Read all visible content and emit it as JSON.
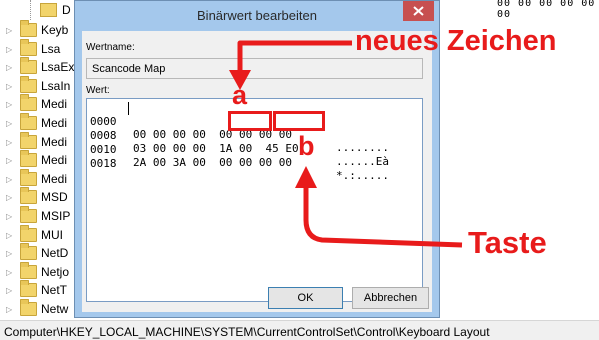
{
  "tree": {
    "top_item": "D",
    "items": [
      "Keyb",
      "Lsa",
      "LsaEx",
      "LsaIn",
      "Medi",
      "Medi",
      "Medi",
      "Medi",
      "Medi",
      "MSD",
      "MSIP",
      "MUI",
      "NetD",
      "Netjo",
      "NetT",
      "Netw"
    ]
  },
  "right_pane": {
    "hex_fragment": "00 00 00 00 00 00"
  },
  "status_bar": {
    "path": "Computer\\HKEY_LOCAL_MACHINE\\SYSTEM\\CurrentControlSet\\Control\\Keyboard Layout"
  },
  "dialog": {
    "title": "Binärwert bearbeiten",
    "value_name_label": "Wertname:",
    "value_name": "Scancode Map",
    "value_data_label": "Wert:",
    "rows": [
      {
        "offset": "0000",
        "bytes": "00 00 00 00  00 00 00 00",
        "ascii": "........"
      },
      {
        "offset": "0008",
        "bytes": "03 00 00 00  1A 00  45 E0",
        "ascii": "......Eà"
      },
      {
        "offset": "0010",
        "bytes": "2A 00 3A 00  00 00 00 00",
        "ascii": "*.:....."
      },
      {
        "offset": "0018",
        "bytes": "",
        "ascii": ""
      }
    ],
    "ok_label": "OK",
    "cancel_label": "Abbrechen"
  },
  "annotations": {
    "new_char": "neues Zeichen",
    "key": "Taste",
    "marker_a": "a",
    "marker_b": "b",
    "color": "#e81b1b"
  }
}
